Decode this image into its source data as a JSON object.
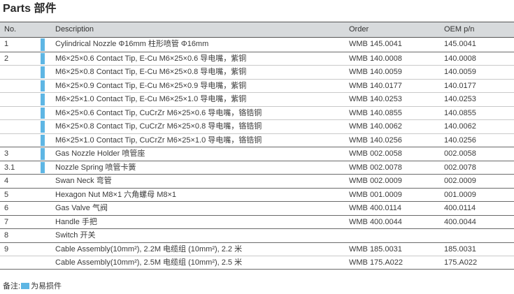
{
  "title": "Parts 部件",
  "header": {
    "no": "No.",
    "description": "Description",
    "order": "Order",
    "oem": "OEM p/n"
  },
  "rows": [
    {
      "no": "1",
      "description": "Cylindrical Nozzle Φ16mm 柱形喷管 Φ16mm",
      "order": "WMB 145.0041",
      "oem": "145.0041",
      "wear": true,
      "group_start": true
    },
    {
      "no": "2",
      "description": "M6×25×0.6 Contact Tip, E-Cu M6×25×0.6 导电嘴，紫铜",
      "order": "WMB 140.0008",
      "oem": "140.0008",
      "wear": true,
      "group_start": true
    },
    {
      "no": "",
      "description": "M6×25×0.8 Contact Tip, E-Cu M6×25×0.8 导电嘴，紫铜",
      "order": "WMB 140.0059",
      "oem": "140.0059",
      "wear": true,
      "group_start": false
    },
    {
      "no": "",
      "description": "M6×25×0.9 Contact Tip, E-Cu M6×25×0.9 导电嘴，紫铜",
      "order": "WMB 140.0177",
      "oem": "140.0177",
      "wear": true,
      "group_start": false
    },
    {
      "no": "",
      "description": "M6×25×1.0 Contact Tip, E-Cu M6×25×1.0 导电嘴，紫铜",
      "order": "WMB 140.0253",
      "oem": "140.0253",
      "wear": true,
      "group_start": false
    },
    {
      "no": "",
      "description": "M6×25×0.6 Contact Tip, CuCrZr M6×25×0.6 导电嘴，铬锆铜",
      "order": "WMB 140.0855",
      "oem": "140.0855",
      "wear": true,
      "group_start": false
    },
    {
      "no": "",
      "description": "M6×25×0.8 Contact Tip, CuCrZr M6×25×0.8 导电嘴，铬锆铜",
      "order": "WMB 140.0062",
      "oem": "140.0062",
      "wear": true,
      "group_start": false
    },
    {
      "no": "",
      "description": "M6×25×1.0 Contact Tip, CuCrZr M6×25×1.0 导电嘴，铬锆铜",
      "order": "WMB 140.0256",
      "oem": "140.0256",
      "wear": true,
      "group_start": false
    },
    {
      "no": "3",
      "description": "Gas Nozzle Holder 喷管座",
      "order": "WMB 002.0058",
      "oem": "002.0058",
      "wear": true,
      "group_start": true
    },
    {
      "no": "3.1",
      "description": "Nozzle Spring 喷管卡簧",
      "order": "WMB 002.0078",
      "oem": "002.0078",
      "wear": true,
      "group_start": true
    },
    {
      "no": "4",
      "description": "Swan Neck 弯管",
      "order": "WMB 002.0009",
      "oem": "002.0009",
      "wear": false,
      "group_start": true
    },
    {
      "no": "5",
      "description": "Hexagon Nut M8×1 六角螺母 M8×1",
      "order": "WMB 001.0009",
      "oem": "001.0009",
      "wear": false,
      "group_start": true
    },
    {
      "no": "6",
      "description": "Gas Valve 气阀",
      "order": "WMB 400.0114",
      "oem": "400.0114",
      "wear": false,
      "group_start": true
    },
    {
      "no": "7",
      "description": "Handle 手把",
      "order": "WMB 400.0044",
      "oem": "400.0044",
      "wear": false,
      "group_start": true
    },
    {
      "no": "8",
      "description": "Switch 开关",
      "order": "",
      "oem": "",
      "wear": false,
      "group_start": true
    },
    {
      "no": "9",
      "description": "Cable Assembly(10mm²), 2.2M 电缆组 (10mm²), 2.2 米",
      "order": "WMB 185.0031",
      "oem": "185.0031",
      "wear": false,
      "group_start": true
    },
    {
      "no": "",
      "description": "Cable Assembly(10mm²), 2.5M 电缆组 (10mm²), 2.5 米",
      "order": "WMB 175.A022",
      "oem": "175.A022",
      "wear": false,
      "group_start": false
    }
  ],
  "note": {
    "prefix": "备注:",
    "label": "为易损件"
  },
  "colors": {
    "wear_marker": "#5eb6e4",
    "header_bg": "#d7dadc"
  }
}
